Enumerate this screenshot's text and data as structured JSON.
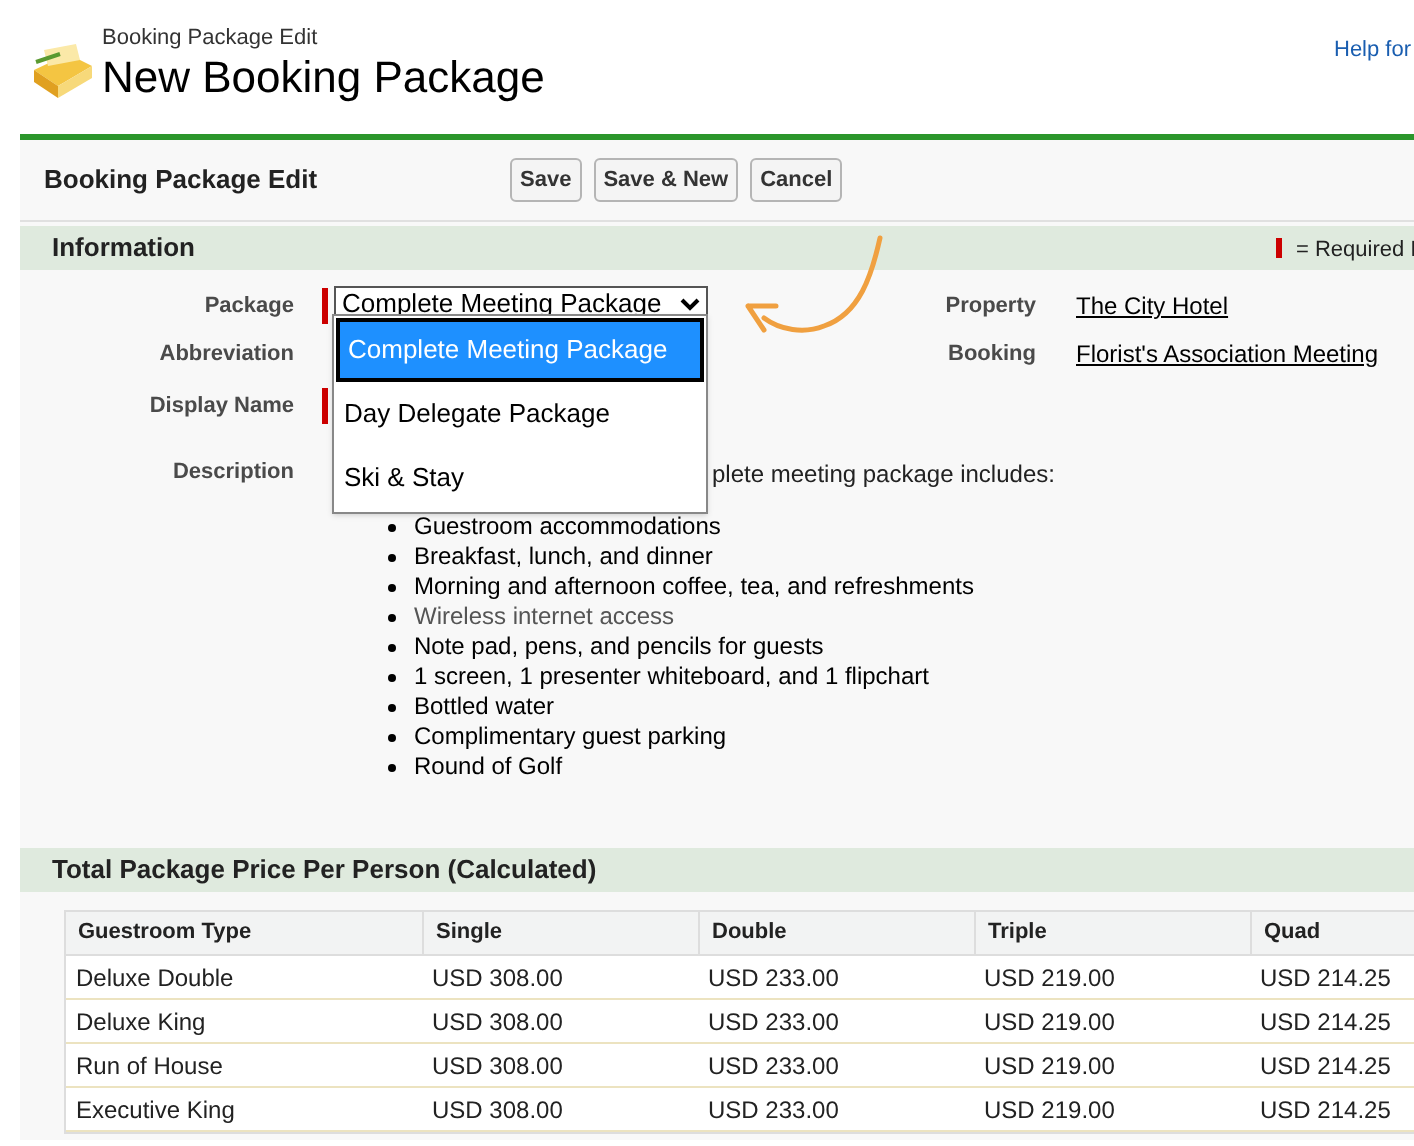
{
  "page_header": {
    "subtitle": "Booking Package Edit",
    "title": "New Booking Package",
    "help_link": "Help for"
  },
  "edit_bar": {
    "title": "Booking Package Edit",
    "buttons": [
      "Save",
      "Save & New",
      "Cancel"
    ]
  },
  "information": {
    "title": "Information",
    "required_legend": "= Required I",
    "fields_left": [
      {
        "label": "Package",
        "required": true,
        "kind": "select",
        "value": "Complete Meeting Package"
      },
      {
        "label": "Abbreviation",
        "required": false,
        "kind": "text"
      },
      {
        "label": "Display Name",
        "required": true,
        "kind": "text"
      },
      {
        "label": "Description",
        "required": false,
        "kind": "description",
        "intro": "plete meeting package includes:",
        "items": [
          "Guestroom accommodations",
          "Breakfast, lunch, and dinner",
          "Morning and afternoon coffee, tea, and refreshments",
          "Wireless internet access",
          "Note pad,  pens, and pencils for guests",
          "1 screen, 1 presenter whiteboard, and 1 flipchart",
          "Bottled water",
          "Complimentary guest parking",
          "Round of Golf"
        ]
      }
    ],
    "fields_right": [
      {
        "label": "Property",
        "value": "The City Hotel"
      },
      {
        "label": "Booking",
        "value": "Florist's Association Meeting"
      }
    ],
    "dropdown_options": [
      {
        "label": "Complete Meeting Package",
        "selected": true
      },
      {
        "label": "Day Delegate Package",
        "selected": false
      },
      {
        "label": "Ski & Stay",
        "selected": false
      }
    ]
  },
  "price_section": {
    "title": "Total Package Price Per Person (Calculated)",
    "table": {
      "columns": [
        "Guestroom Type",
        "Single",
        "Double",
        "Triple",
        "Quad"
      ],
      "rows": [
        [
          "Deluxe Double",
          "USD 308.00",
          "USD 233.00",
          "USD 219.00",
          "USD 214.25"
        ],
        [
          "Deluxe King",
          "USD 308.00",
          "USD 233.00",
          "USD 219.00",
          "USD 214.25"
        ],
        [
          "Run of House",
          "USD 308.00",
          "USD 233.00",
          "USD 219.00",
          "USD 214.25"
        ],
        [
          "Executive King",
          "USD 308.00",
          "USD 233.00",
          "USD 219.00",
          "USD 214.25"
        ]
      ]
    }
  }
}
